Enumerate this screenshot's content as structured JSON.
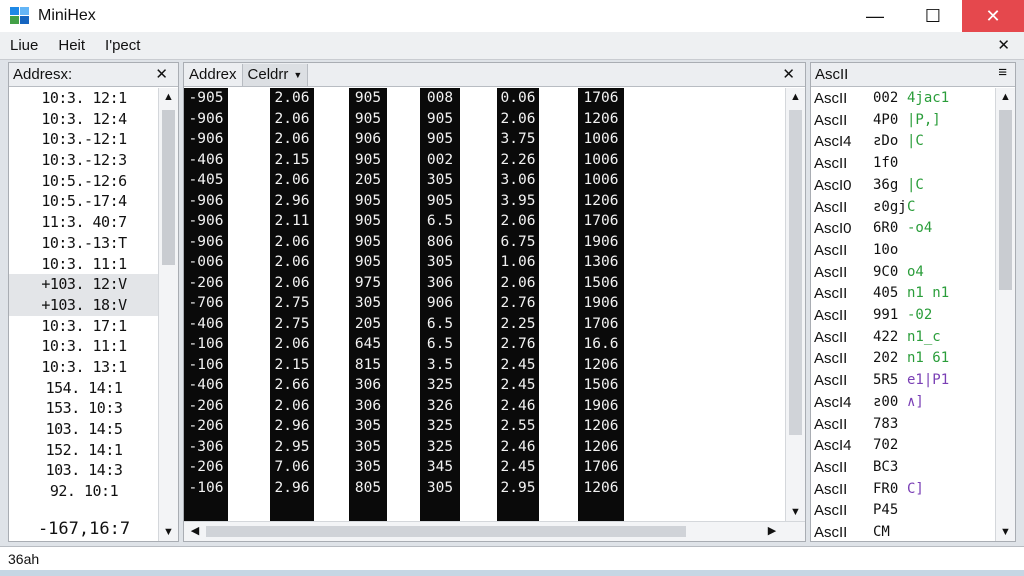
{
  "window": {
    "title": "MiniHex",
    "minimize": "—",
    "maximize": "☐",
    "close": "✕"
  },
  "menu": {
    "items": [
      "Liue",
      "Heit",
      "I'pect"
    ],
    "close": "✕"
  },
  "address_panel": {
    "title": "Addresx:",
    "close": "✕",
    "rows": [
      "10:3. 12:1",
      "10:3. 12:4",
      "10:3.-12:1",
      "10:3.-12:3",
      "10:5.-12:6",
      "10:5.-17:4",
      "11:3. 40:7",
      "10:3.-13:T",
      "10:3. 11:1",
      "+103. 12:V",
      "+103. 18:V",
      "10:3. 17:1",
      "10:3. 11:1",
      "10:3. 13:1",
      "154. 14:1",
      "153. 10:3",
      "103. 14:5",
      "152. 14:1",
      "103. 14:3",
      "92. 10:1"
    ],
    "last": "-167,16:7",
    "up": "▲",
    "down": "▼"
  },
  "hex_panel": {
    "tabs": [
      "Addrex",
      "Celdrr"
    ],
    "close": "✕",
    "columns": [
      [
        "-905",
        "-906",
        "-906",
        "-406",
        "-405",
        "-906",
        "-906",
        "-906",
        "-006",
        "-206",
        "-706",
        "-406",
        "-106",
        "-106",
        "-406",
        "-206",
        "-206",
        "-306",
        "-206",
        "-106"
      ],
      [
        "2.06",
        "2.06",
        "2.06",
        "2.15",
        "2.06",
        "2.96",
        "2.11",
        "2.06",
        "2.06",
        "2.06",
        "2.75",
        "2.75",
        "2.06",
        "2.15",
        "2.66",
        "2.06",
        "2.96",
        "2.95",
        "7.06",
        "2.96"
      ],
      [
        "905",
        "905",
        "906",
        "905",
        "205",
        "905",
        "905",
        "905",
        "905",
        "975",
        "305",
        "205",
        "645",
        "815",
        "306",
        "306",
        "305",
        "305",
        "305",
        "805"
      ],
      [
        "008",
        "905",
        "905",
        "002",
        "305",
        "905",
        "6.5",
        "806",
        "305",
        "306",
        "906",
        "6.5",
        "6.5",
        "3.5",
        "325",
        "326",
        "325",
        "325",
        "345",
        "305"
      ],
      [
        "0.06",
        "2.06",
        "3.75",
        "2.26",
        "3.06",
        "3.95",
        "2.06",
        "6.75",
        "1.06",
        "2.06",
        "2.76",
        "2.25",
        "2.76",
        "2.45",
        "2.45",
        "2.46",
        "2.55",
        "2.46",
        "2.45",
        "2.95"
      ],
      [
        "1706",
        "1206",
        "1006",
        "1006",
        "1006",
        "1206",
        "1706",
        "1906",
        "1306",
        "1506",
        "1906",
        "1706",
        "16.6",
        "1206",
        "1506",
        "1906",
        "1206",
        "1206",
        "1706",
        "1206"
      ]
    ],
    "left": "◀",
    "right": "▶",
    "up": "▲",
    "down": "▼"
  },
  "ascii_panel": {
    "title": "AscII",
    "menu": "≡",
    "rows": [
      {
        "label": "AscII",
        "code": "002",
        "chars": "4jac1",
        "purple": false
      },
      {
        "label": "AscII",
        "code": "4P0",
        "chars": "|P,]",
        "purple": false
      },
      {
        "label": "AscI4",
        "code": "ƨDo",
        "chars": "|C",
        "purple": false
      },
      {
        "label": "AscII",
        "code": "1f0",
        "chars": "",
        "purple": false
      },
      {
        "label": "AscI0",
        "code": "36g",
        "chars": "|C",
        "purple": false
      },
      {
        "label": "AscII",
        "code": "ƨ0gj",
        "chars": "C",
        "purple": false
      },
      {
        "label": "AscI0",
        "code": "6R0",
        "chars": "-o4",
        "purple": false
      },
      {
        "label": "AscII",
        "code": "10o",
        "chars": "",
        "purple": false
      },
      {
        "label": "AscII",
        "code": "9C0",
        "chars": "o4",
        "purple": false
      },
      {
        "label": "AscII",
        "code": "405",
        "chars": "n1 n1",
        "purple": false
      },
      {
        "label": "AscII",
        "code": "991",
        "chars": "-02",
        "purple": false
      },
      {
        "label": "AscII",
        "code": "422",
        "chars": "n1_c",
        "purple": false
      },
      {
        "label": "AscII",
        "code": "202",
        "chars": "n1 61",
        "purple": false
      },
      {
        "label": "AscII",
        "code": "5R5",
        "chars": "e1|P1",
        "purple": true
      },
      {
        "label": "AscI4",
        "code": "ƨ00",
        "chars": "∧]",
        "purple": true
      },
      {
        "label": "AscII",
        "code": "783",
        "chars": "",
        "purple": false
      },
      {
        "label": "AscI4",
        "code": "702",
        "chars": "",
        "purple": false
      },
      {
        "label": "AscII",
        "code": "BC3",
        "chars": "",
        "purple": false
      },
      {
        "label": "AscII",
        "code": "FR0",
        "chars": "C]",
        "purple": true
      },
      {
        "label": "AscII",
        "code": "P45",
        "chars": "",
        "purple": false
      },
      {
        "label": "AscII",
        "code": "CM",
        "chars": "",
        "purple": false
      }
    ],
    "up": "▲",
    "down": "▼"
  },
  "status": {
    "text": "36ah"
  },
  "colors": {
    "accent_green": "#2a9d3a",
    "accent_purple": "#7a3fb5",
    "close_red": "#e5484d",
    "hex_bg": "#0a0a0a"
  }
}
